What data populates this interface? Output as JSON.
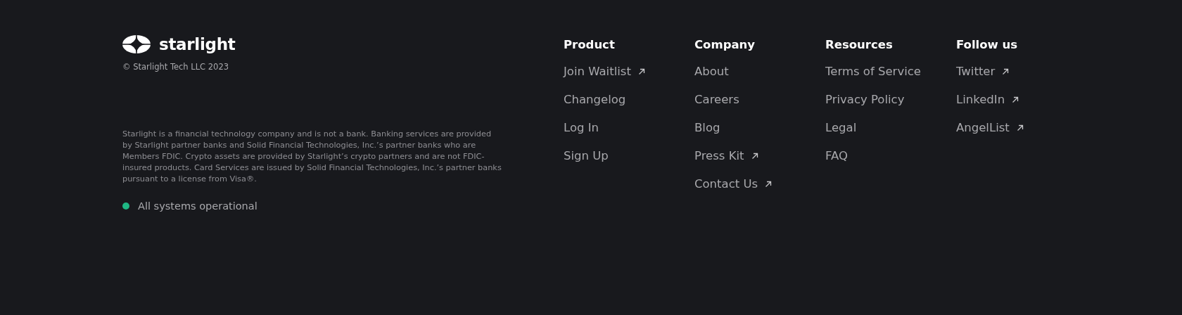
{
  "brand": {
    "name": "starlight",
    "copyright": "© Starlight Tech LLC 2023"
  },
  "disclaimer": "Starlight is a financial technology company and is not a bank. Banking services are provided by Starlight partner banks and Solid Financial Technologies, Inc.’s partner banks who are Members FDIC. Crypto assets are provided by Starlight’s crypto partners and are not FDIC-insured products. Card Services are issued by Solid Financial Technologies, Inc.’s partner banks pursuant to a license from Visa®.",
  "status": {
    "label": "All systems operational",
    "color": "#1fb784"
  },
  "columns": [
    {
      "heading": "Product",
      "links": [
        {
          "label": "Join Waitlist",
          "external": true
        },
        {
          "label": "Changelog",
          "external": false
        },
        {
          "label": "Log In",
          "external": false
        },
        {
          "label": "Sign Up",
          "external": false
        }
      ]
    },
    {
      "heading": "Company",
      "links": [
        {
          "label": "About",
          "external": false
        },
        {
          "label": "Careers",
          "external": false
        },
        {
          "label": "Blog",
          "external": false
        },
        {
          "label": "Press Kit",
          "external": true
        },
        {
          "label": "Contact Us",
          "external": true
        }
      ]
    },
    {
      "heading": "Resources",
      "links": [
        {
          "label": "Terms of Service",
          "external": false
        },
        {
          "label": "Privacy Policy",
          "external": false
        },
        {
          "label": "Legal",
          "external": false
        },
        {
          "label": "FAQ",
          "external": false
        }
      ]
    },
    {
      "heading": "Follow us",
      "links": [
        {
          "label": "Twitter",
          "external": true
        },
        {
          "label": "LinkedIn",
          "external": true
        },
        {
          "label": "AngelList",
          "external": true
        }
      ]
    }
  ]
}
